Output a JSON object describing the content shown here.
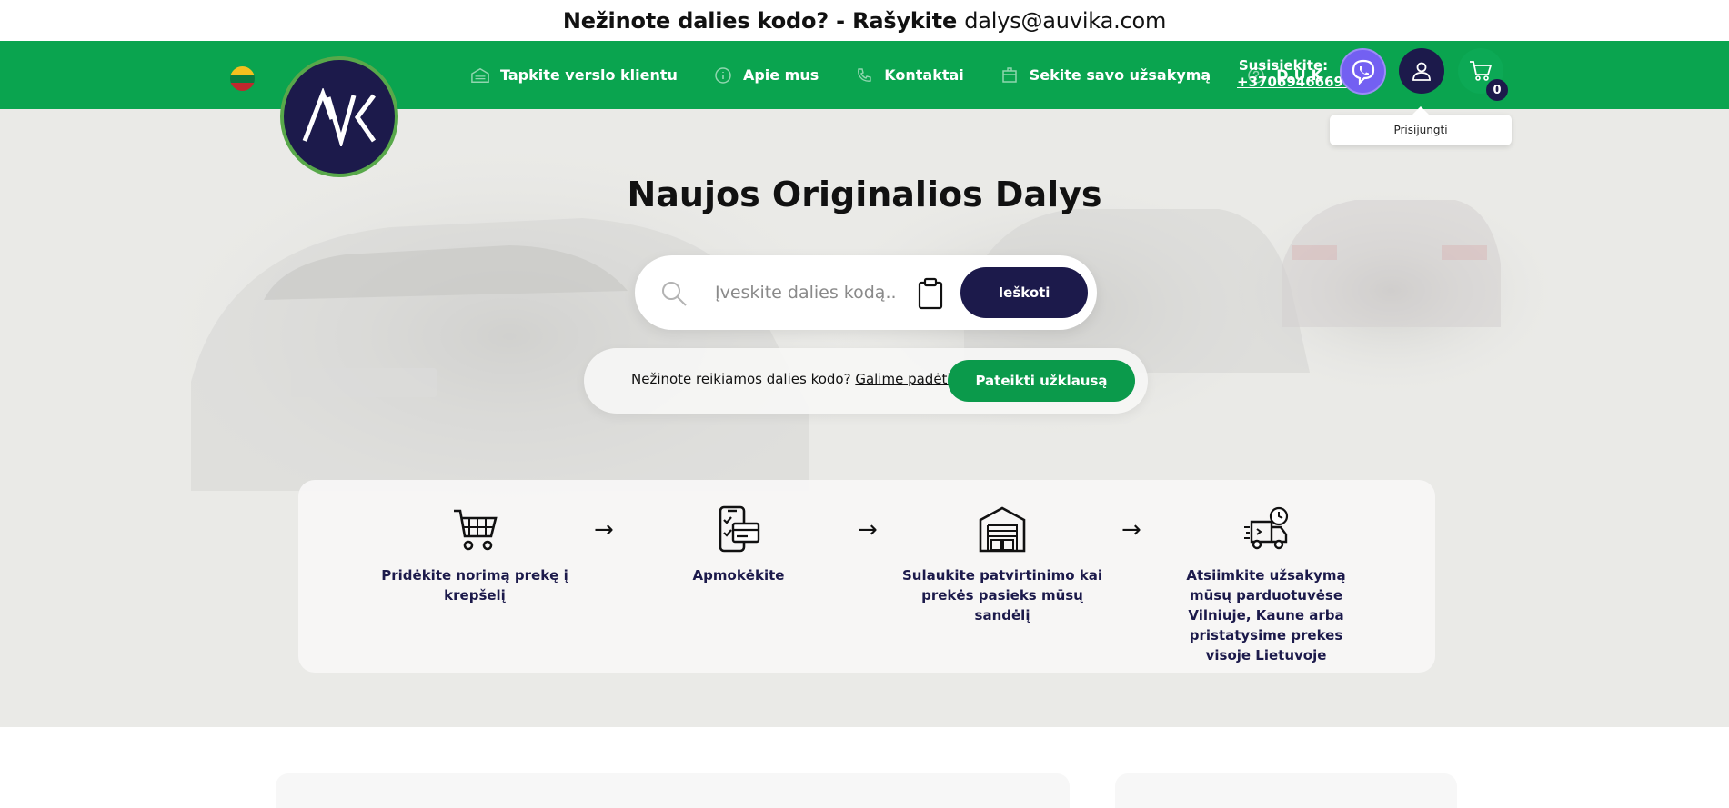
{
  "announcement": {
    "text": "Nežinote dalies kodo? - Rašykite ",
    "email": "dalys@auvika.com"
  },
  "header": {
    "flag": "lithuania-flag",
    "logo_text": "AVK",
    "nav": [
      {
        "label": "Tapkite verslo klientu",
        "icon": "garage-icon"
      },
      {
        "label": "Apie mus",
        "icon": "info-icon"
      },
      {
        "label": "Kontaktai",
        "icon": "phone-icon"
      },
      {
        "label": "Sekite savo užsakymą",
        "icon": "package-icon"
      },
      {
        "label": "D.U.K",
        "icon": "question-icon"
      }
    ],
    "contact_label": "Susisiekite:",
    "contact_phone": "+37069466699",
    "cart_count": "0",
    "login_tooltip": "Prisijungti"
  },
  "hero": {
    "title": "Naujos Originalios Dalys",
    "search_placeholder": "Įveskite dalies kodą...",
    "search_button": "Ieškoti",
    "help_text": "Nežinote reikiamos dalies kodo? ",
    "help_link": "Galime padėti!",
    "request_button": "Pateikti užklausą"
  },
  "steps": [
    {
      "icon": "cart-icon",
      "label": "Pridėkite norimą prekę į krepšelį"
    },
    {
      "icon": "phone-payment-icon",
      "label": "Apmokėkite"
    },
    {
      "icon": "warehouse-icon",
      "label": "Sulaukite patvirtinimo kai prekės pasieks mūsų sandėlį"
    },
    {
      "icon": "delivery-truck-icon",
      "label": "Atsiimkite užsakymą mūsų parduotuvėse Vilniuje, Kaune arba pristatysime prekes visoje Lietuvoje"
    }
  ],
  "step_arrow": "→",
  "colors": {
    "brand_green": "#0aa44f",
    "brand_navy": "#1c1a4b",
    "viber_purple": "#7360f2"
  }
}
